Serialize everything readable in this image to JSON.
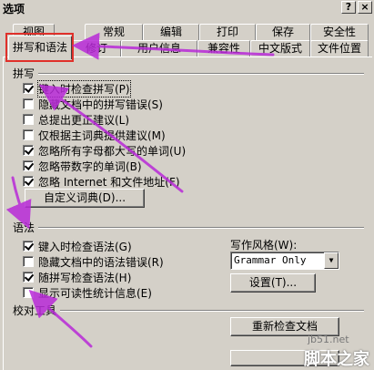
{
  "window": {
    "title": "选项",
    "help_glyph": "?",
    "close_glyph": "×"
  },
  "tabs_row1": [
    "视图",
    "常规",
    "编辑",
    "打印",
    "保存",
    "安全性"
  ],
  "tabs_row2": [
    "拼写和语法",
    "修订",
    "用户信息",
    "兼容性",
    "中文版式",
    "文件位置"
  ],
  "spelling": {
    "group_label": "拼写",
    "options": [
      {
        "label": "键入时检查拼写(P)",
        "checked": true
      },
      {
        "label": "隐藏文档中的拼写错误(S)",
        "checked": false
      },
      {
        "label": "总提出更正建议(L)",
        "checked": false
      },
      {
        "label": "仅根据主词典提供建议(M)",
        "checked": false
      },
      {
        "label": "忽略所有字母都大写的单词(U)",
        "checked": true
      },
      {
        "label": "忽略带数字的单词(B)",
        "checked": true
      },
      {
        "label": "忽略 Internet 和文件地址(F)",
        "checked": true
      }
    ],
    "custom_dict_button": "自定义词典(D)..."
  },
  "grammar": {
    "group_label": "语法",
    "options": [
      {
        "label": "键入时检查语法(G)",
        "checked": true
      },
      {
        "label": "隐藏文档中的语法错误(R)",
        "checked": false
      },
      {
        "label": "随拼写检查语法(H)",
        "checked": true
      },
      {
        "label": "显示可读性统计信息(E)",
        "checked": false
      }
    ],
    "writing_style_label": "写作风格(W):",
    "writing_style_value": "Grammar Only",
    "settings_button": "设置(T)..."
  },
  "proofing": {
    "group_label": "校对工具",
    "recheck_button": "重新检查文档"
  },
  "watermark": {
    "site": "jb51.net",
    "brand": "脚本之家"
  },
  "colors": {
    "highlight_red": "#e0302a",
    "arrow_magenta": "#b82ad8"
  }
}
